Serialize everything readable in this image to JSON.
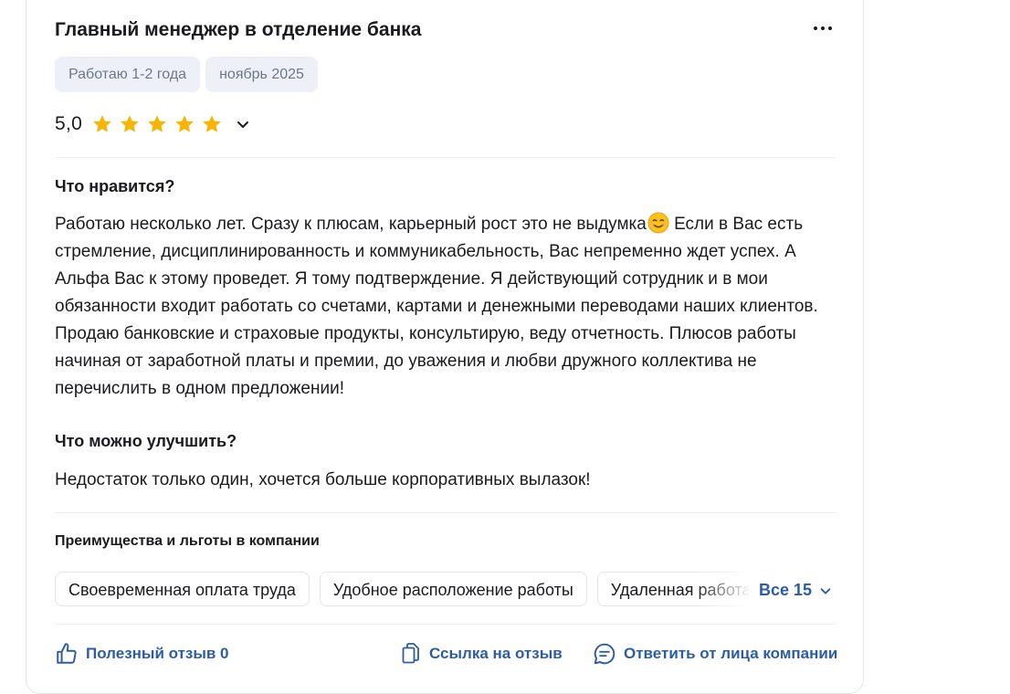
{
  "review": {
    "title": "Главный менеджер в отделение банка",
    "tags": [
      "Работаю 1-2 года",
      "ноябрь 2025"
    ],
    "rating": "5,0",
    "stars": 5,
    "sections": {
      "likes_heading": "Что нравится?",
      "likes_text_1": "Работаю несколько лет. Сразу к плюсам, карьерный рост это не выдумка",
      "likes_text_2": " Если в Вас есть стремление, дисциплинированность и коммуникабельность, Вас непременно ждет успех. А Альфа Вас к этому проведет. Я тому подтверждение. Я действующий сотрудник и в мои обязанности входит работать со счетами, картами и денежными переводами наших клиентов. Продаю банковские и страховые продукты, консультирую, веду отчетность. Плюсов работы начиная от заработной платы и премии, до уважения и любви дружного коллектива не перечислить в одном предложении!",
      "improve_heading": "Что можно улучшить?",
      "improve_text": "Недостаток только один, хочется больше корпоративных вылазок!"
    },
    "benefits": {
      "heading": "Преимущества и льготы в компании",
      "items": [
        "Своевременная оплата труда",
        "Удобное расположение работы",
        "Удаленная работа"
      ],
      "all_label": "Все 15"
    },
    "actions": {
      "helpful": "Полезный отзыв 0",
      "link": "Ссылка на отзыв",
      "reply": "Ответить от лица компании"
    }
  },
  "colors": {
    "accent": "#2d5ca6",
    "star": "#f7b500",
    "chip_bg": "#edf0f6"
  },
  "icons": [
    "more-icon",
    "star-icon",
    "chevron-down-icon",
    "smile-emoji-icon",
    "thumbs-up-icon",
    "copy-link-icon",
    "comment-icon"
  ]
}
